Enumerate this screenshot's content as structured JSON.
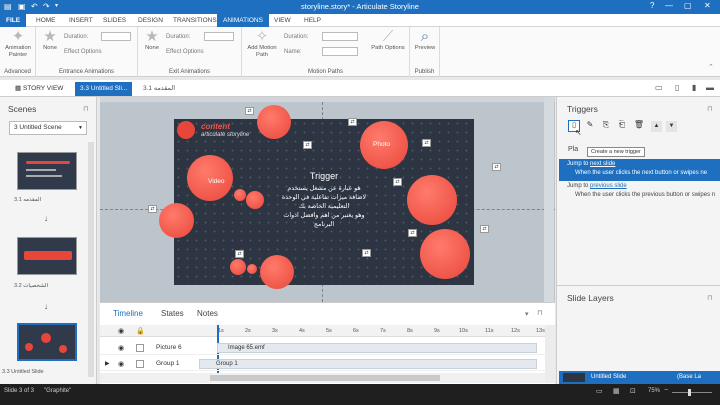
{
  "window": {
    "title": "storyline.story* - Articulate Storyline",
    "help": "?"
  },
  "ribbon_tabs": [
    "FILE",
    "HOME",
    "INSERT",
    "SLIDES",
    "DESIGN",
    "TRANSITIONS",
    "ANIMATIONS",
    "VIEW",
    "HELP"
  ],
  "active_tab": "ANIMATIONS",
  "ribbon": {
    "animation_painter": "Animation Painter",
    "entrance_none": "None",
    "entrance_duration": "Duration:",
    "entrance_effect": "Effect Options",
    "exit_none": "None",
    "exit_duration": "Duration:",
    "exit_effect": "Effect Options",
    "add_motion": "Add Motion Path",
    "motion_duration": "Duration:",
    "motion_name": "Name:",
    "path_options": "Path Options",
    "preview": "Preview",
    "groups": {
      "advanced": "Advanced",
      "entrance": "Entrance Animations",
      "exit": "Exit Animations",
      "motion": "Motion Paths",
      "publish": "Publish"
    }
  },
  "viewbar": {
    "story_view": "STORY VIEW",
    "tab_active": "3.3 Untitled Sli...",
    "tab_other": "3.1 المقدمه"
  },
  "scenes": {
    "title": "Scenes",
    "dropdown": "3 Untitled Scene",
    "items": [
      {
        "label": "3.1 المقدمه"
      },
      {
        "label": "3.2 الشخصيات"
      },
      {
        "label": "3.3 Untitled Slide"
      }
    ]
  },
  "slide": {
    "brand_title": "content",
    "brand_sub": "articulate storyline",
    "video_label": "Video",
    "photo_label": "Photo",
    "trigger_title": "Trigger",
    "trigger_lines": [
      "هو عبارة عن مشغل يستخدم",
      "لاضافة ميزات تفاعلية في الوحدة",
      "التعليمية الخاصة بك",
      "وهو يعتبر من اهم وافضل ادوات",
      "البرنامج"
    ]
  },
  "timeline": {
    "tabs": [
      "Timeline",
      "States",
      "Notes"
    ],
    "ticks": [
      "1s",
      "2s",
      "3s",
      "4s",
      "5s",
      "6s",
      "7s",
      "8s",
      "9s",
      "10s",
      "11s",
      "12s",
      "13s"
    ],
    "rows": [
      {
        "name": "Picture 6",
        "clip": "Image 65.emf"
      },
      {
        "name": "Group 1",
        "clip": "Group 1"
      }
    ]
  },
  "triggers": {
    "title": "Triggers",
    "tooltip": "Create a new trigger",
    "partial": "Pla",
    "items": [
      {
        "pre": "Jump to ",
        "link": "next slide",
        "desc": "When the user clicks the next button or swipes ne"
      },
      {
        "pre": "Jump to ",
        "link": "previous slide",
        "desc": "When the user clicks the previous button or swipes n"
      }
    ],
    "slide_layers": "Slide Layers",
    "layer_item": "Untitled Slide",
    "layer_base": "(Base La"
  },
  "status": {
    "slide": "Slide 3 of 3",
    "theme": "\"Graphite\"",
    "zoom": "75%"
  },
  "colors": {
    "accent": "#1e6fbf",
    "circle": "#f0544a",
    "slide_bg": "#2d3442",
    "brand": "#f0544a"
  }
}
